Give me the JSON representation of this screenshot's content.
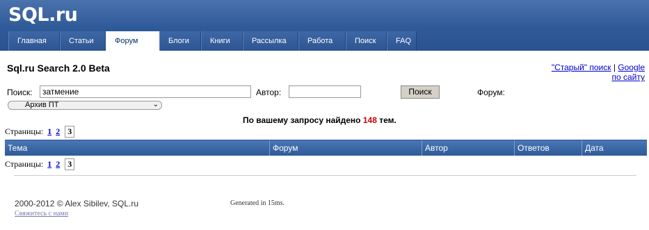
{
  "header": {
    "logo": "SQL.ru",
    "nav": [
      {
        "label": "Главная"
      },
      {
        "label": "Статьи"
      },
      {
        "label": "Форум"
      },
      {
        "label": "Блоги"
      },
      {
        "label": "Книги"
      },
      {
        "label": "Рассылка"
      },
      {
        "label": "Работа"
      },
      {
        "label": "Поиск"
      },
      {
        "label": "FAQ"
      }
    ],
    "active_tab": "Форум"
  },
  "page": {
    "title": "Sql.ru Search 2.0 Beta",
    "old_search_link": "\"Старый\" поиск",
    "separator": " | ",
    "google_link_1": "Google",
    "google_link_2": "по сайту"
  },
  "search": {
    "query_label": "Поиск:",
    "query_value": "затмение",
    "author_label": "Автор:",
    "author_value": "",
    "button": "Поиск",
    "forum_label": "Форум:",
    "forum_selected": "Архив ПТ"
  },
  "result": {
    "prefix": "По вашему запросу найдено ",
    "count": "148",
    "suffix": " тем."
  },
  "pagination": {
    "label": "Страницы:",
    "pages": [
      "1",
      "2"
    ],
    "current": "3"
  },
  "table": {
    "columns": [
      "Тема",
      "Форум",
      "Автор",
      "Ответов",
      "Дата"
    ]
  },
  "footer": {
    "copyright": "2000-2012 © Alex Sibilev, SQL.ru",
    "contact": "Свяжитесь с нами",
    "generated": "Generated in 15ms."
  },
  "colors": {
    "header_blue": "#2f5a98",
    "result_count": "#cc0000",
    "link": "#0000cc"
  }
}
